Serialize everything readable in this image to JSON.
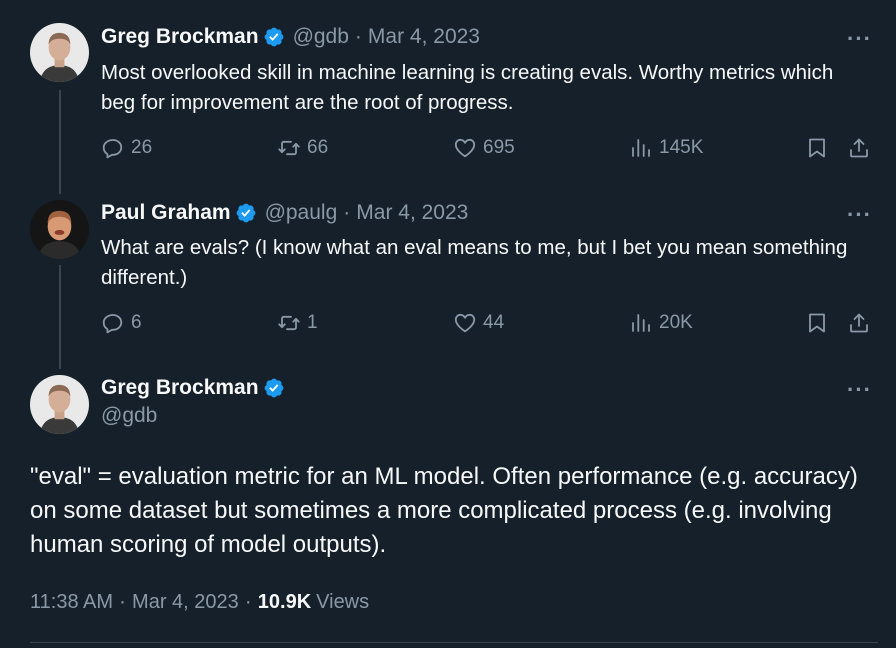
{
  "tweets": [
    {
      "name": "Greg Brockman",
      "handle": "@gdb",
      "sep": "·",
      "date": "Mar 4, 2023",
      "more": "···",
      "text": "Most overlooked skill in machine learning is creating evals. Worthy metrics which beg for improvement are the root of progress.",
      "replies": "26",
      "retweets": "66",
      "likes": "695",
      "views": "145K"
    },
    {
      "name": "Paul Graham",
      "handle": "@paulg",
      "sep": "·",
      "date": "Mar 4, 2023",
      "more": "···",
      "text": "What are evals? (I know what an eval means to me, but I bet you mean something different.)",
      "replies": "6",
      "retweets": "1",
      "likes": "44",
      "views": "20K"
    }
  ],
  "main": {
    "name": "Greg Brockman",
    "handle": "@gdb",
    "more": "···",
    "text": "\"eval\" = evaluation metric for an ML model. Often performance (e.g. accuracy) on some dataset but sometimes a more complicated process (e.g. involving human scoring of model outputs).",
    "time": "11:38 AM",
    "sep1": "·",
    "date": "Mar 4, 2023",
    "sep2": "·",
    "views_count": "10.9K",
    "views_label": "Views"
  },
  "colors": {
    "background": "#15202b",
    "text": "#f7f9f9",
    "muted": "#8b98a5",
    "verified": "#1d9bf0",
    "border": "#38444d"
  },
  "icons": [
    "verified-badge-icon",
    "reply-icon",
    "retweet-icon",
    "like-icon",
    "views-icon",
    "bookmark-icon",
    "share-icon",
    "more-icon"
  ]
}
